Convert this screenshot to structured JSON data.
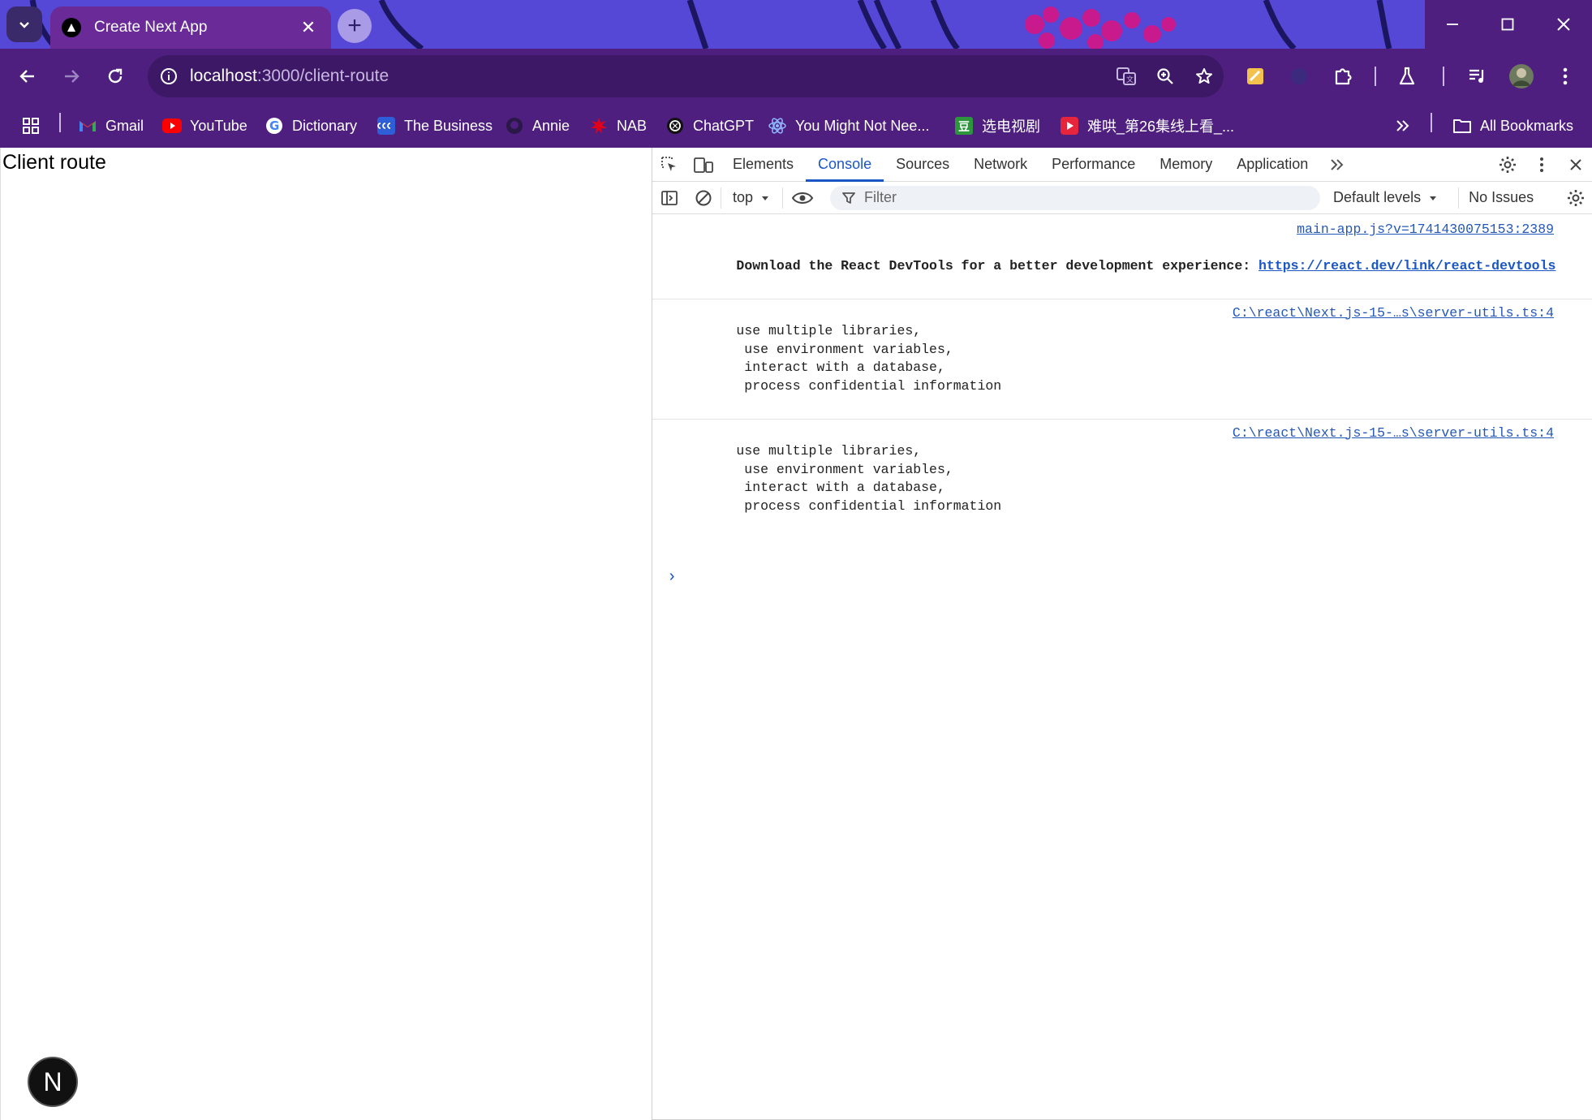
{
  "browser": {
    "tab_title": "Create Next App",
    "url_host": "localhost",
    "url_path": ":3000/client-route"
  },
  "bookmarks": [
    {
      "label": "Gmail",
      "icon": "gmail-icon"
    },
    {
      "label": "YouTube",
      "icon": "youtube-icon"
    },
    {
      "label": "Dictionary",
      "icon": "google-icon"
    },
    {
      "label": "The Business",
      "icon": "abc-icon"
    },
    {
      "label": "Annie",
      "icon": "github-icon"
    },
    {
      "label": "NAB",
      "icon": "nab-icon"
    },
    {
      "label": "ChatGPT",
      "icon": "openai-icon"
    },
    {
      "label": "You Might Not Nee...",
      "icon": "react-icon"
    },
    {
      "label": "选电视剧",
      "icon": "douban-icon"
    },
    {
      "label": "难哄_第26集线上看_...",
      "icon": "play-icon"
    }
  ],
  "bookmarks_all": "All Bookmarks",
  "page": {
    "heading": "Client route",
    "badge": "N"
  },
  "devtools": {
    "tabs": [
      "Elements",
      "Console",
      "Sources",
      "Network",
      "Performance",
      "Memory",
      "Application"
    ],
    "active_tab": "Console",
    "context": "top",
    "filter_placeholder": "Filter",
    "levels": "Default levels",
    "issues": "No Issues",
    "messages": [
      {
        "source": "main-app.js?v=1741430075153:2389",
        "prefix": "Download the React DevTools for a better development experience: ",
        "link": "https://react.dev/link/react-devtools"
      },
      {
        "source": "C:\\react\\Next.js-15-…s\\server-utils.ts:4",
        "text": "use multiple libraries,\n       use environment variables,\n       interact with a database,\n       process confidential information"
      },
      {
        "source": "C:\\react\\Next.js-15-…s\\server-utils.ts:4",
        "text": "use multiple libraries,\n       use environment variables,\n       interact with a database,\n       process confidential information"
      }
    ]
  },
  "colors": {
    "frame": "#4f1f80",
    "tab_active": "#6a2a98",
    "accent_blue": "#1a56c4"
  }
}
